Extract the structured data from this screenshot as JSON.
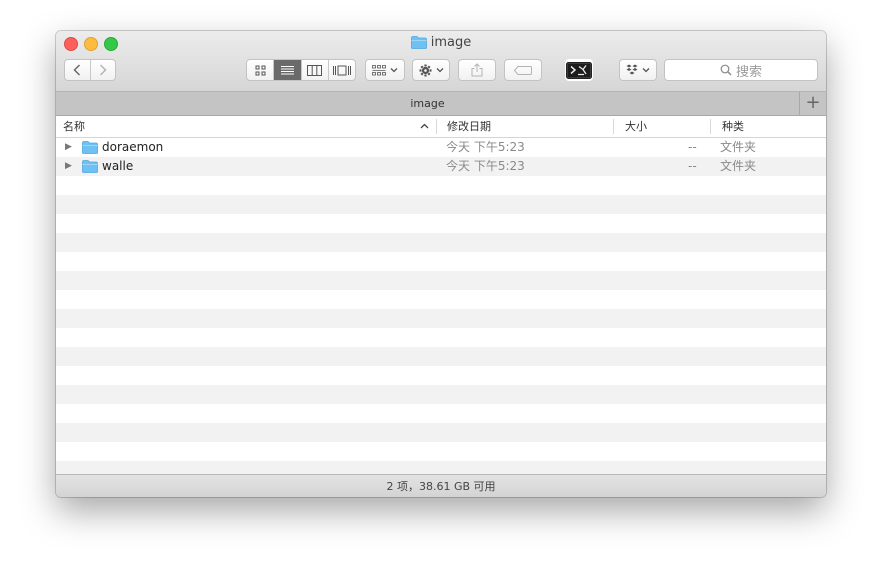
{
  "window": {
    "title": "image"
  },
  "toolbar": {
    "back_icon": "chevron-left-icon",
    "forward_icon": "chevron-right-icon",
    "view_modes": [
      "icon-view-icon",
      "list-view-icon",
      "column-view-icon",
      "coverflow-view-icon"
    ],
    "active_view": "list-view-icon",
    "search_placeholder": "搜索"
  },
  "tabbar": {
    "tab_label": "image"
  },
  "columns": {
    "name": "名称",
    "date": "修改日期",
    "size": "大小",
    "kind": "种类"
  },
  "files": [
    {
      "name": "doraemon",
      "date": "今天 下午5:23",
      "size": "--",
      "kind": "文件夹"
    },
    {
      "name": "walle",
      "date": "今天 下午5:23",
      "size": "--",
      "kind": "文件夹"
    }
  ],
  "status": {
    "text": "2 项，38.61 GB 可用"
  },
  "colors": {
    "folder": "#6ec1f2",
    "active_segment": "#6a6a6a"
  }
}
